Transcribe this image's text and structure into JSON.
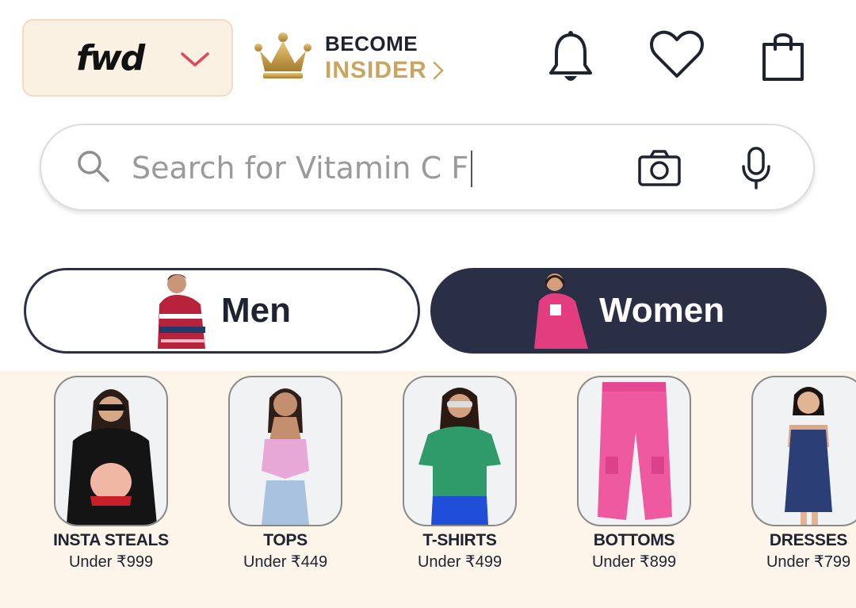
{
  "header": {
    "brand_logo": "fwd",
    "become": "BECOME",
    "insider": "INSIDER",
    "icons": [
      "chevron-down-icon",
      "crown-icon",
      "chevron-right-icon",
      "bell-icon",
      "heart-icon",
      "bag-icon"
    ]
  },
  "search": {
    "placeholder": "Search for Vitamin C F",
    "icons": [
      "search-icon",
      "camera-icon",
      "mic-icon"
    ]
  },
  "gender": {
    "men": "Men",
    "women": "Women",
    "selected": "Women"
  },
  "categories": [
    {
      "name": "INSTA STEALS",
      "price": "Under ₹999"
    },
    {
      "name": "TOPS",
      "price": "Under ₹449"
    },
    {
      "name": "T-SHIRTS",
      "price": "Under ₹499"
    },
    {
      "name": "BOTTOMS",
      "price": "Under ₹899"
    },
    {
      "name": "DRESSES",
      "price": "Under ₹799"
    }
  ],
  "colors": {
    "accent_dark": "#2b2f45",
    "gold": "#c9a560",
    "chevron_pink": "#e0475c",
    "strip_bg": "#fdf5ea"
  }
}
